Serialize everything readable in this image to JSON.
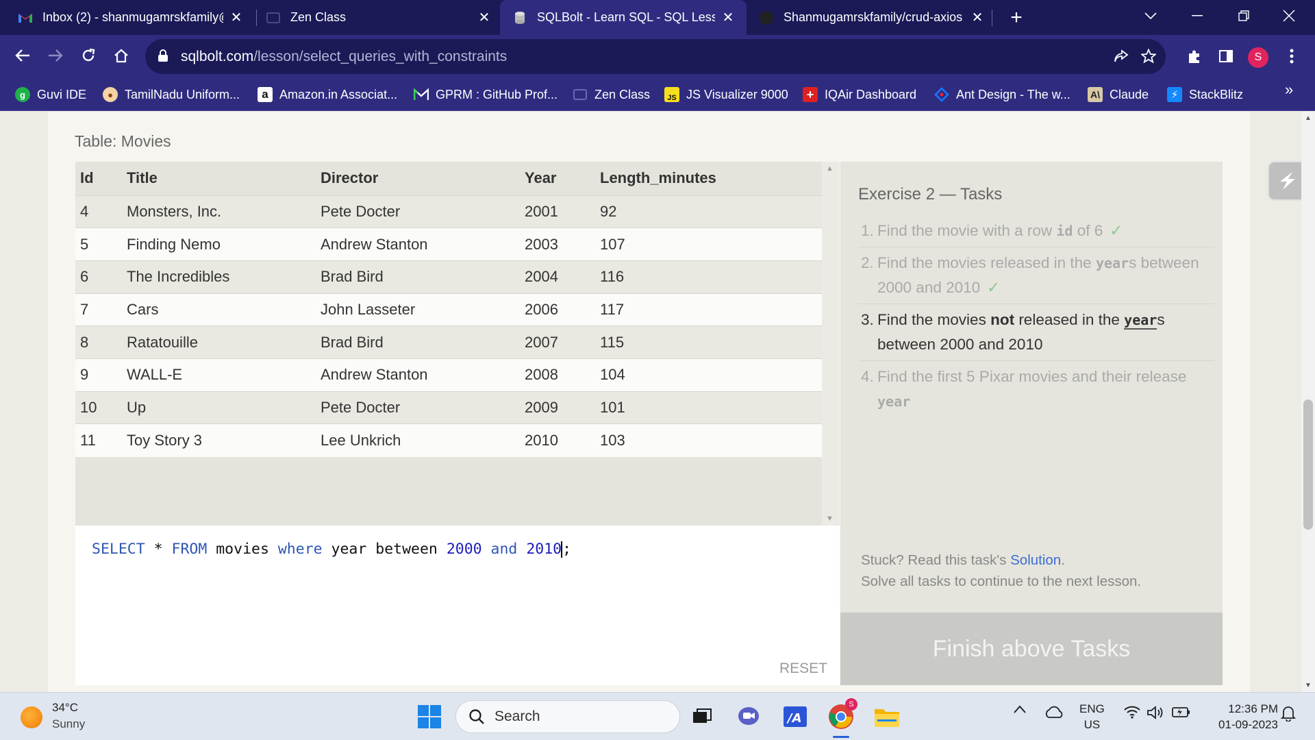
{
  "browser": {
    "tabs": [
      {
        "title": "Inbox (2) - shanmugamrskfamily@",
        "icon": "gmail-icon"
      },
      {
        "title": "Zen Class",
        "icon": "zen-class-icon"
      },
      {
        "title": "SQLBolt - Learn SQL - SQL Lesson",
        "icon": "sqlbolt-icon"
      },
      {
        "title": "Shanmugamrskfamily/crud-axios",
        "icon": "github-icon"
      }
    ],
    "url_domain": "sqlbolt.com",
    "url_path": "/lesson/select_queries_with_constraints",
    "profile_initial": "S"
  },
  "bookmarks": [
    {
      "label": "Guvi IDE",
      "icon": "guvi-icon"
    },
    {
      "label": "TamilNadu Uniform...",
      "icon": "tn-emblem-icon"
    },
    {
      "label": "Amazon.in Associat...",
      "icon": "amazon-icon"
    },
    {
      "label": "GPRM : GitHub Prof...",
      "icon": "gprm-icon"
    },
    {
      "label": "Zen Class",
      "icon": "zen-class-icon"
    },
    {
      "label": "JS Visualizer 9000",
      "icon": "js-icon"
    },
    {
      "label": "IQAir Dashboard",
      "icon": "iqair-icon"
    },
    {
      "label": "Ant Design - The w...",
      "icon": "antdesign-icon"
    },
    {
      "label": "Claude",
      "icon": "claude-icon"
    },
    {
      "label": "StackBlitz",
      "icon": "stackblitz-icon"
    }
  ],
  "lesson": {
    "table_caption": "Table: Movies",
    "columns": [
      "Id",
      "Title",
      "Director",
      "Year",
      "Length_minutes"
    ],
    "rows": [
      [
        "4",
        "Monsters, Inc.",
        "Pete Docter",
        "2001",
        "92"
      ],
      [
        "5",
        "Finding Nemo",
        "Andrew Stanton",
        "2003",
        "107"
      ],
      [
        "6",
        "The Incredibles",
        "Brad Bird",
        "2004",
        "116"
      ],
      [
        "7",
        "Cars",
        "John Lasseter",
        "2006",
        "117"
      ],
      [
        "8",
        "Ratatouille",
        "Brad Bird",
        "2007",
        "115"
      ],
      [
        "9",
        "WALL-E",
        "Andrew Stanton",
        "2008",
        "104"
      ],
      [
        "10",
        "Up",
        "Pete Docter",
        "2009",
        "101"
      ],
      [
        "11",
        "Toy Story 3",
        "Lee Unkrich",
        "2010",
        "103"
      ]
    ],
    "query_tokens": [
      {
        "t": "SELECT",
        "k": "kw"
      },
      {
        "t": " * ",
        "k": ""
      },
      {
        "t": "FROM",
        "k": "kw"
      },
      {
        "t": " movies ",
        "k": ""
      },
      {
        "t": "where",
        "k": "kw"
      },
      {
        "t": " year between ",
        "k": ""
      },
      {
        "t": "2000",
        "k": "num"
      },
      {
        "t": " ",
        "k": ""
      },
      {
        "t": "and",
        "k": "kw"
      },
      {
        "t": " ",
        "k": ""
      },
      {
        "t": "2010",
        "k": "num"
      }
    ],
    "query_suffix": ";",
    "reset_label": "RESET",
    "exercise_title": "Exercise 2 — Tasks",
    "tasks": {
      "t1": {
        "num": "1.",
        "pre": "Find the movie with a row ",
        "code": "id",
        "post": " of 6",
        "check": "✓"
      },
      "t2": {
        "num": "2.",
        "pre": "Find the movies released in the ",
        "code": "year",
        "post": "s between 2000 and 2010",
        "check": "✓"
      },
      "t3": {
        "num": "3.",
        "pre": "Find the movies ",
        "strong": "not",
        "mid": " released in the ",
        "code": "year",
        "post": "s between 2000 and 2010"
      },
      "t4": {
        "num": "4.",
        "pre": "Find the first 5 Pixar movies and their release ",
        "code": "year"
      }
    },
    "stuck_pre": "Stuck? Read this task's ",
    "stuck_link": "Solution",
    "stuck_post": ".",
    "solve_all": "Solve all tasks to continue to the next lesson.",
    "finish_label": "Finish above Tasks"
  },
  "taskbar": {
    "weather_temp": "34°C",
    "weather_desc": "Sunny",
    "search_placeholder": "Search",
    "lang_top": "ENG",
    "lang_bottom": "US",
    "time": "12:36 PM",
    "date": "01-09-2023",
    "chrome_badge": "S"
  }
}
